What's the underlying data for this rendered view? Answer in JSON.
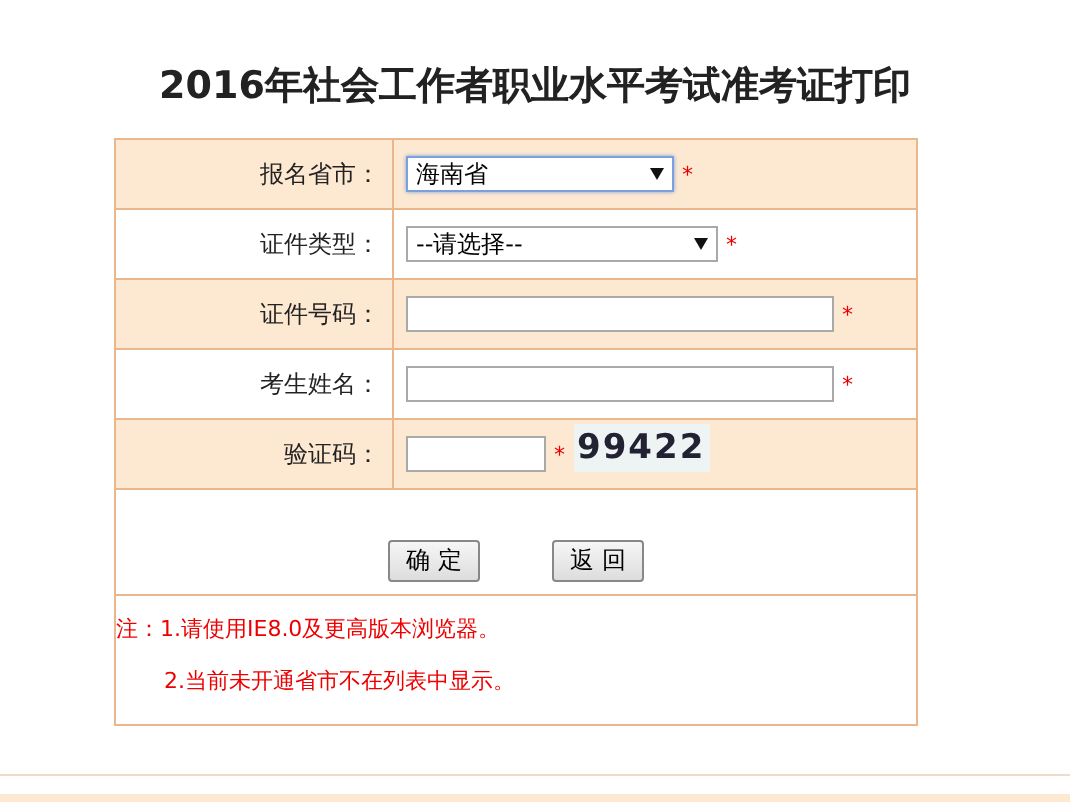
{
  "title": "2016年社会工作者职业水平考试准考证打印",
  "fields": [
    {
      "label": "报名省市：",
      "kind": "select",
      "value": "海南省",
      "focused": true,
      "required": "*"
    },
    {
      "label": "证件类型：",
      "kind": "select",
      "value": "--请选择--",
      "focused": false,
      "required": "*"
    },
    {
      "label": "证件号码：",
      "kind": "input",
      "required": "*"
    },
    {
      "label": "考生姓名：",
      "kind": "input",
      "required": "*"
    },
    {
      "label": "验证码：",
      "kind": "captcha",
      "required": "*",
      "captcha": "99422"
    }
  ],
  "buttons": [
    "确 定",
    "返 回"
  ],
  "notes": [
    {
      "prefix": "注：",
      "text": "1.请使用IE8.0及更高版本浏览器。"
    },
    {
      "text": "2.当前未开通省市不在列表中显示。"
    }
  ]
}
